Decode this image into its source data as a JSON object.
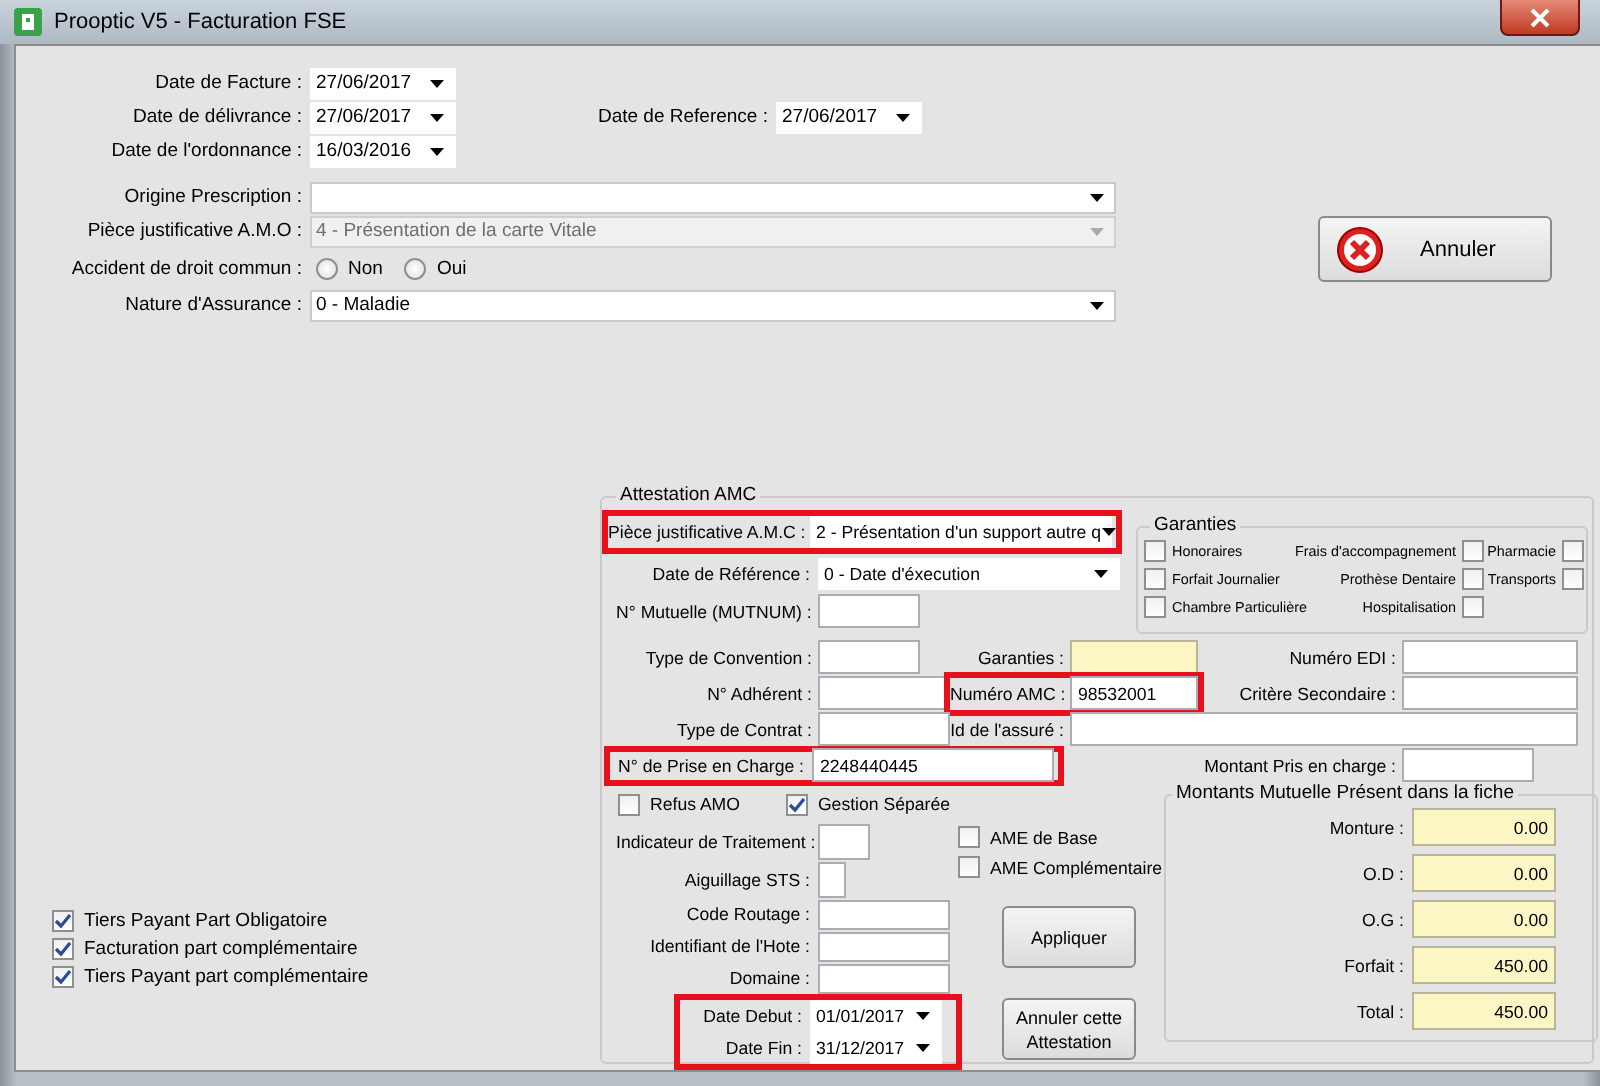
{
  "window": {
    "title": "Prooptic V5 - Facturation FSE"
  },
  "dates": [
    {
      "label": "Date de Facture :",
      "value": "27/06/2017"
    },
    {
      "label": "Date de délivrance :",
      "value": "27/06/2017"
    },
    {
      "label": "Date de l'ordonnance :",
      "value": "16/03/2016"
    }
  ],
  "reference_date": {
    "label": "Date de Reference :",
    "value": "27/06/2017"
  },
  "origine_prescription": {
    "label": "Origine Prescription :"
  },
  "piece_amo": {
    "label": "Pièce justificative A.M.O :",
    "value": "4 - Présentation de la carte Vitale",
    "disabled": true
  },
  "accident": {
    "label": "Accident de droit commun :",
    "options": [
      {
        "label": "Non",
        "selected": false
      },
      {
        "label": "Oui",
        "selected": false
      }
    ]
  },
  "nature_assurance": {
    "label": "Nature d'Assurance :",
    "value": "0 - Maladie"
  },
  "cancel_button": {
    "label": "Annuler"
  },
  "options": [
    {
      "label": "Tiers Payant Part Obligatoire",
      "checked": true
    },
    {
      "label": "Facturation part complémentaire",
      "checked": true
    },
    {
      "label": "Tiers Payant part complémentaire",
      "checked": true
    }
  ],
  "amc": {
    "title": "Attestation AMC",
    "piece": {
      "label": "Pièce justificative A.M.C :",
      "value": "2 - Présentation d'un support autre q",
      "highlighted": true
    },
    "date_reference": {
      "label": "Date de Référence :",
      "value": "0 - Date d'éxecution"
    },
    "mutnum": {
      "label": "N° Mutuelle (MUTNUM) :"
    },
    "garanties_box": {
      "title": "Garanties",
      "items": [
        {
          "label": "Honoraires",
          "checked": false,
          "kind": "box_left"
        },
        {
          "label": "Frais d'accompagnement",
          "checked": false,
          "kind": "box_right"
        },
        {
          "label": "Pharmacie",
          "checked": false,
          "kind": "box_right"
        },
        {
          "label": "Forfait Journalier",
          "checked": false,
          "kind": "box_left"
        },
        {
          "label": "Prothèse Dentaire",
          "checked": false,
          "kind": "box_right"
        },
        {
          "label": "Transports",
          "checked": false,
          "kind": "box_right"
        },
        {
          "label": "Chambre Particulière",
          "checked": false,
          "kind": "box_left"
        },
        {
          "label": "Hospitalisation",
          "checked": false,
          "kind": "box_right"
        }
      ]
    },
    "convention": {
      "label": "Type de Convention :"
    },
    "garanties_field": {
      "label": "Garanties :",
      "readonly": true
    },
    "numero_edi": {
      "label": "Numéro EDI :"
    },
    "adherent": {
      "label": "N° Adhérent :"
    },
    "numero_amc": {
      "label": "Numéro AMC :",
      "value": "98532001",
      "highlighted": true
    },
    "critere": {
      "label": "Critère Secondaire :"
    },
    "contrat": {
      "label": "Type de Contrat :"
    },
    "id_assure": {
      "label": "Id de l'assuré :"
    },
    "prise_en_charge": {
      "label": "N° de Prise en Charge :",
      "value": "2248440445",
      "highlighted": true
    },
    "montant_pris": {
      "label": "Montant Pris en charge :"
    },
    "refus_amo": {
      "label": "Refus AMO",
      "checked": false
    },
    "gestion_separee": {
      "label": "Gestion Séparée",
      "checked": true
    },
    "indicateur": {
      "label": "Indicateur de Traitement :"
    },
    "aiguillage": {
      "label": "Aiguillage STS :"
    },
    "code_routage": {
      "label": "Code Routage :"
    },
    "identifiant": {
      "label": "Identifiant de l'Hote :"
    },
    "domaine": {
      "label": "Domaine :"
    },
    "period": {
      "highlighted": true,
      "start": {
        "label": "Date Debut :",
        "value": "01/01/2017"
      },
      "end": {
        "label": "Date Fin :",
        "value": "31/12/2017"
      }
    },
    "ame": [
      {
        "label": "AME de Base",
        "checked": false
      },
      {
        "label": "AME Complémentaire",
        "checked": false
      }
    ],
    "apply_button": {
      "label": "Appliquer"
    },
    "cancel_attestation_button": {
      "label": "Annuler cette Attestation"
    },
    "montants": {
      "title": "Montants Mutuelle Présent dans la fiche",
      "rows": [
        {
          "label": "Monture :",
          "value": "0.00"
        },
        {
          "label": "O.D :",
          "value": "0.00"
        },
        {
          "label": "O.G :",
          "value": "0.00"
        },
        {
          "label": "Forfait :",
          "value": "450.00"
        },
        {
          "label": "Total :",
          "value": "450.00"
        }
      ]
    }
  }
}
